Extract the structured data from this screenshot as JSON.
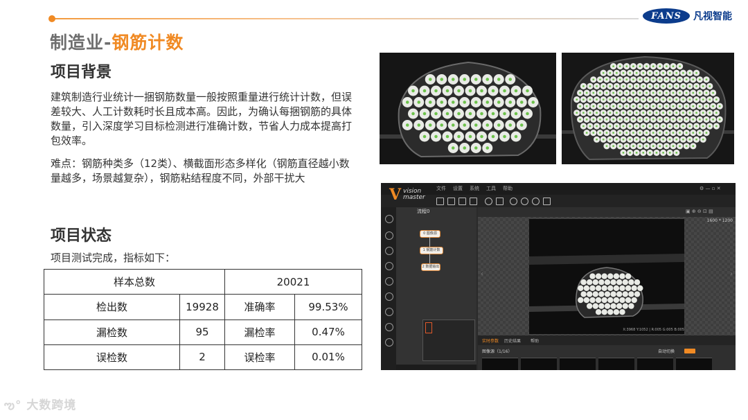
{
  "header": {
    "brand_logo": "FANS",
    "brand_name": "凡视智能",
    "accent_color": "#f08a24"
  },
  "title": {
    "prefix": "制造业-",
    "highlight": "钢筋计数"
  },
  "background": {
    "heading": "项目背景",
    "paragraph1": "建筑制造行业统计一捆钢筋数量一般按照重量进行统计计数，但误差较大、人工计数耗时长且成本高。因此，为确认每捆钢筋的具体数量，引入深度学习目标检测进行准确计数，节省人力成本提高打包效率。",
    "paragraph2": "难点：钢筋种类多（12类）、横截面形态多样化（钢筋直径越小数量越多，场景越复杂），钢筋粘结程度不同，外部干扰大"
  },
  "status": {
    "heading": "项目状态",
    "intro": "项目测试完成，指标如下：",
    "table": {
      "total_label": "样本总数",
      "total_value": "20021",
      "rows": [
        {
          "label": "检出数",
          "value": "19928",
          "rate_label": "准确率",
          "rate_value": "99.53%"
        },
        {
          "label": "漏检数",
          "value": "95",
          "rate_label": "漏检率",
          "rate_value": "0.47%"
        },
        {
          "label": "误检数",
          "value": "2",
          "rate_label": "误检率",
          "rate_value": "0.01%"
        }
      ]
    }
  },
  "software": {
    "logo_letter": "V",
    "logo_text_top": "vision",
    "logo_text_bottom": "master",
    "menu": [
      "文件",
      "设置",
      "系统",
      "工具",
      "帮助"
    ],
    "flow_tab": "流程0",
    "nodes": [
      "0 图像源",
      "1 钢筋计数",
      "2 数据输出"
    ],
    "resolution": "1600 * 1200",
    "coords": "X:3968 Y:1052 | R:005 G:005 B:005",
    "tabs": [
      "实时参数",
      "历史结果",
      "帮助"
    ],
    "image_list": "图像源（1/16）",
    "auto_switch": "自动切换"
  },
  "watermark": "大数跨境"
}
